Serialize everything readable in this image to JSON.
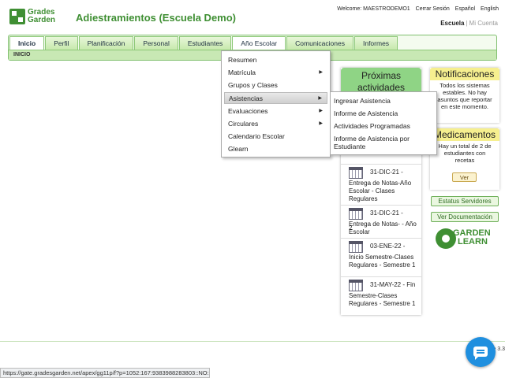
{
  "header": {
    "logo_line1": "Grades",
    "logo_line2": "Garden",
    "title": "Adiestramientos (Escuela Demo)",
    "welcome": "Welcome: MAESTRODEMO1",
    "logout": "Cerrar Sesión",
    "lang_es": "Español",
    "lang_en": "English",
    "school": "Escuela",
    "my_account": "Mi Cuenta"
  },
  "nav": {
    "tabs": [
      "Inicio",
      "Perfil",
      "Planificación",
      "Personal",
      "Estudiantes",
      "Año Escolar",
      "Comunicaciones",
      "Informes"
    ],
    "sub_label": "INICIO"
  },
  "menu": {
    "items": [
      "Resumen",
      "Matrícula",
      "Grupos y Clases",
      "Asistencias",
      "Evaluaciones",
      "Circulares",
      "Calendario Escolar",
      "Glearn"
    ]
  },
  "submenu": {
    "items": [
      "Ingresar Asistencia",
      "Informe de Asistencia",
      "Actividades Programadas",
      "Informe de Asistencia por Estudiante"
    ]
  },
  "activities": {
    "title": "Próximas actividades",
    "partial_number": "2",
    "items": [
      {
        "date": "31-DIC-21 -",
        "desc": "Entrega de Notas-Año Escolar - Clases Regulares"
      },
      {
        "date": "31-DIC-21 -",
        "desc": "Entrega de Notas- - Año Escolar"
      },
      {
        "date": "03-ENE-22 -",
        "desc": "Inicio Semestre-Clases Regulares - Semestre 1"
      },
      {
        "date": "31-MAY-22 - Fin",
        "desc": "Semestre-Clases Regulares - Semestre 1"
      }
    ]
  },
  "notifications": {
    "title": "Notificaciones",
    "body": "Todos los sistemas estables. No hay asuntos que reportar en este momento."
  },
  "medications": {
    "title": "Medicamentos",
    "body": "Hay un total de 2 de estudiantes con recetas",
    "button": "Ver"
  },
  "sidebar_buttons": {
    "server_status": "Estatus Servidores",
    "documentation": "Ver Documentación"
  },
  "glearn_logo": {
    "line1": "GARDEN",
    "line2": "LEARN"
  },
  "version": "e 3.3",
  "status_url": "https://gate.gradesgarden.net/apex/gg11p/f?p=1052:167:9383988283803::NO::::"
}
